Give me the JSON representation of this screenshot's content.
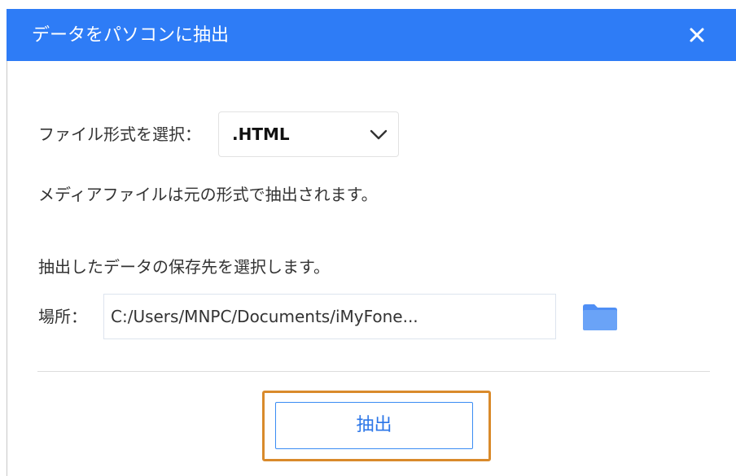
{
  "window": {
    "title": "データをパソコンに抽出",
    "close_icon": "close-icon",
    "title_bar_color": "#2e7cf6"
  },
  "format": {
    "label": "ファイル形式を選択：",
    "selected": ".HTML",
    "note": "メディアファイルは元の形式で抽出されます。"
  },
  "destination": {
    "instruction": "抽出したデータの保存先を選択します。",
    "label": "場所：",
    "path": "C:/Users/MNPC/Documents/iMyFone...",
    "folder_icon": "folder-icon"
  },
  "actions": {
    "extract_label": "抽出",
    "accent_color": "#2b76e8",
    "highlight_color": "#d98a2b"
  }
}
